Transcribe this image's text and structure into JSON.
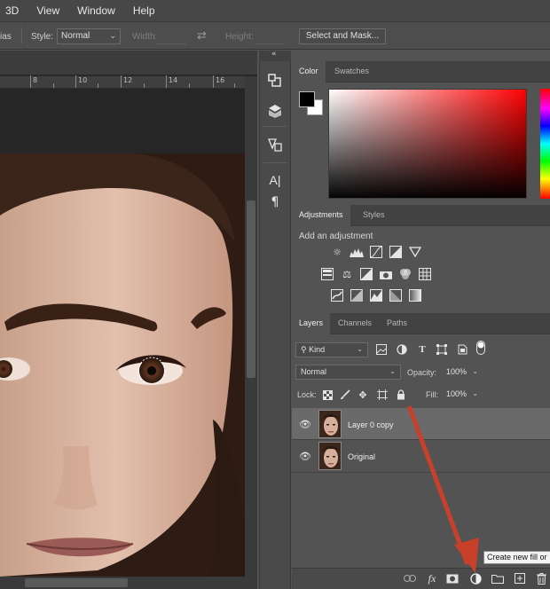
{
  "menu": {
    "items": [
      "3D",
      "View",
      "Window",
      "Help"
    ]
  },
  "options_bar": {
    "anti_alias_fragment": "ias",
    "style_label": "Style:",
    "style_value": "Normal",
    "width_label": "Width:",
    "height_label": "Height:",
    "select_mask_label": "Select and Mask..."
  },
  "ruler": {
    "numbers": [
      "8",
      "10",
      "12",
      "14",
      "16"
    ]
  },
  "toolstrip": {
    "collapse_glyph": "«",
    "type_tool_glyph": "A|",
    "paragraph_glyph": "¶"
  },
  "color_panel": {
    "tabs": [
      "Color",
      "Swatches"
    ],
    "foreground": "#000000",
    "background": "#ffffff"
  },
  "adjustments_panel": {
    "tabs": [
      "Adjustments",
      "Styles"
    ],
    "title": "Add an adjustment"
  },
  "layers_panel": {
    "tabs": [
      "Layers",
      "Channels",
      "Paths"
    ],
    "filter_value": "Kind",
    "blend_mode": "Normal",
    "opacity_label": "Opacity:",
    "opacity_value": "100%",
    "lock_label": "Lock:",
    "fill_label": "Fill:",
    "fill_value": "100%",
    "layers": [
      {
        "name": "Layer 0 copy",
        "selected": true,
        "visible": true
      },
      {
        "name": "Original",
        "selected": false,
        "visible": true
      }
    ],
    "bottom_fx_label": "fx",
    "tooltip": "Create new fill or"
  },
  "colors": {
    "arrow": "#c9402a",
    "panel_bg": "#535353",
    "selected_row": "#6a6a6a"
  }
}
